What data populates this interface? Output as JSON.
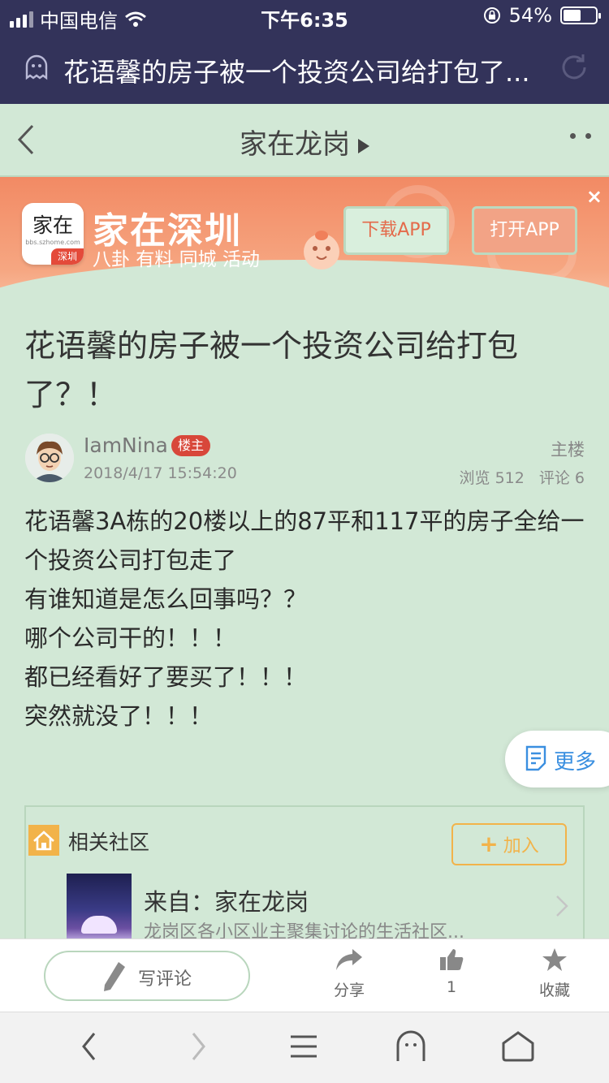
{
  "status_bar": {
    "carrier": "中国电信",
    "time": "下午6:35",
    "battery_percent": "54%",
    "battery_level": 0.54
  },
  "browser": {
    "page_title": "花语馨的房子被一个投资公司给打包了..."
  },
  "nav": {
    "title": "家在龙岗"
  },
  "banner": {
    "app_logo_text": "家在",
    "app_logo_url": "bbs.szhome.com",
    "app_logo_tag": "深圳",
    "app_name": "家在深圳",
    "tagline": "八卦 有料 同城 活动",
    "download_button": "下载APP",
    "open_button": "打开APP",
    "close_label": "×"
  },
  "post": {
    "title": "花语馨的房子被一个投资公司给打包了？！",
    "author": "IamNina",
    "author_badge": "楼主",
    "date": "2018/4/17 15:54:20",
    "floor_label": "主楼",
    "views_label": "浏览 512",
    "comments_label": "评论 6",
    "body_lines": [
      "花语馨3A栋的20楼以上的87平和117平的房子全给一个投资公司打包走了",
      "有谁知道是怎么回事吗？？",
      "哪个公司干的！！！",
      "都已经看好了要买了！！！",
      "突然就没了！！！"
    ],
    "more_button": "更多"
  },
  "community": {
    "title": "相关社区",
    "join_button": "加入",
    "from_label": "来自：家在龙岗",
    "description": "龙岗区各小区业主聚集讨论的生活社区..."
  },
  "action_bar": {
    "write_comment": "写评论",
    "share": "分享",
    "like_count": "1",
    "favorite": "收藏"
  },
  "colors": {
    "header_bg": "#33335a",
    "page_bg": "#d2e8d6",
    "banner_orange": "#f28a64",
    "badge_red": "#d8473a",
    "accent_yellow": "#f2b34a",
    "link_blue": "#3a8fe0"
  }
}
